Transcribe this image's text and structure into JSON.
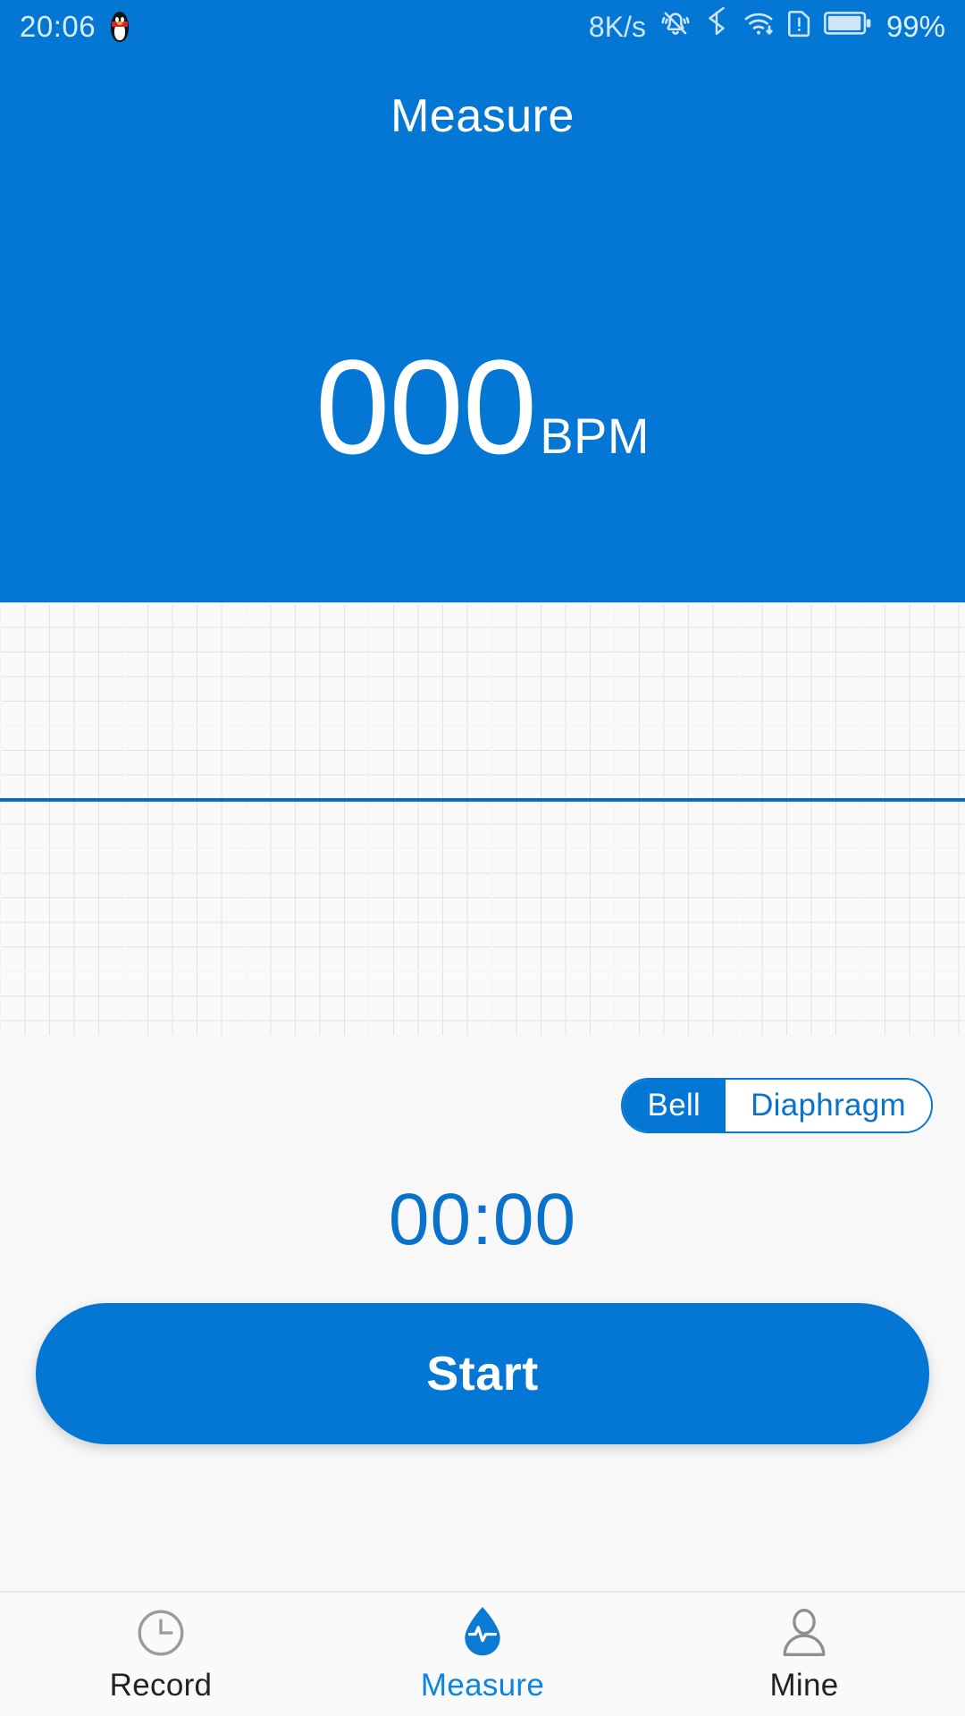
{
  "status_bar": {
    "time": "20:06",
    "app_icon": "qq-penguin-icon",
    "network_speed": "8K/s",
    "icons": [
      "bell-muted-icon",
      "bluetooth-icon",
      "wifi-icon",
      "sim-alert-icon",
      "battery-icon"
    ],
    "battery_percent": "99%"
  },
  "header": {
    "title": "Measure"
  },
  "reading": {
    "value": "000",
    "unit": "BPM"
  },
  "chart": {
    "type": "ecg-waveform-grid",
    "baseline_visible": true,
    "trace_points": [],
    "grid_color": "#e2e2e2",
    "baseline_color": "#0a69c4"
  },
  "mode_toggle": {
    "selected": "Bell",
    "options": [
      {
        "label": "Bell",
        "selected": true
      },
      {
        "label": "Diaphragm",
        "selected": false
      }
    ]
  },
  "timer": {
    "value": "00:00"
  },
  "actions": {
    "start_label": "Start"
  },
  "tabbar": {
    "active": "Measure",
    "items": [
      {
        "label": "Record",
        "icon": "clock-icon",
        "active": false
      },
      {
        "label": "Measure",
        "icon": "droplet-pulse-icon",
        "active": true
      },
      {
        "label": "Mine",
        "icon": "person-icon",
        "active": false
      }
    ]
  },
  "colors": {
    "brand_blue": "#0477d4",
    "accent_blue": "#0a86e0",
    "grid_bg": "#fafafa",
    "page_bg": "#f8f8f8"
  }
}
